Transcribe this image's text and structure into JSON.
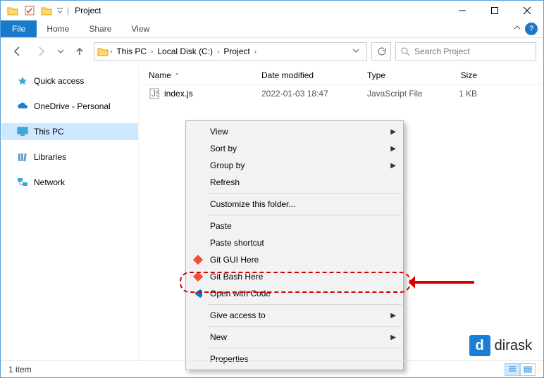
{
  "window": {
    "title": "Project"
  },
  "ribbon": {
    "file": "File",
    "tabs": [
      "Home",
      "Share",
      "View"
    ]
  },
  "breadcrumb": {
    "items": [
      "This PC",
      "Local Disk (C:)",
      "Project"
    ]
  },
  "search": {
    "placeholder": "Search Project"
  },
  "sidebar": {
    "items": [
      {
        "label": "Quick access",
        "icon": "star"
      },
      {
        "label": "OneDrive - Personal",
        "icon": "cloud"
      },
      {
        "label": "This PC",
        "icon": "monitor",
        "selected": true
      },
      {
        "label": "Libraries",
        "icon": "libraries"
      },
      {
        "label": "Network",
        "icon": "network"
      }
    ]
  },
  "columns": {
    "name": "Name",
    "date": "Date modified",
    "type": "Type",
    "size": "Size"
  },
  "files": [
    {
      "name": "index.js",
      "date": "2022-01-03 18:47",
      "type": "JavaScript File",
      "size": "1 KB"
    }
  ],
  "context_menu": {
    "items": [
      {
        "label": "View",
        "submenu": true
      },
      {
        "label": "Sort by",
        "submenu": true
      },
      {
        "label": "Group by",
        "submenu": true
      },
      {
        "label": "Refresh"
      },
      {
        "sep": true
      },
      {
        "label": "Customize this folder..."
      },
      {
        "sep": true
      },
      {
        "label": "Paste",
        "disabled": true
      },
      {
        "label": "Paste shortcut",
        "disabled": true
      },
      {
        "label": "Git GUI Here",
        "icon": "git"
      },
      {
        "label": "Git Bash Here",
        "icon": "git"
      },
      {
        "label": "Open with Code",
        "icon": "vscode",
        "highlighted": true
      },
      {
        "sep": true
      },
      {
        "label": "Give access to",
        "submenu": true
      },
      {
        "sep": true
      },
      {
        "label": "New",
        "submenu": true
      },
      {
        "sep": true
      },
      {
        "label": "Properties"
      }
    ]
  },
  "status": {
    "text": "1 item"
  },
  "watermark": {
    "letter": "d",
    "text": "dirask"
  }
}
